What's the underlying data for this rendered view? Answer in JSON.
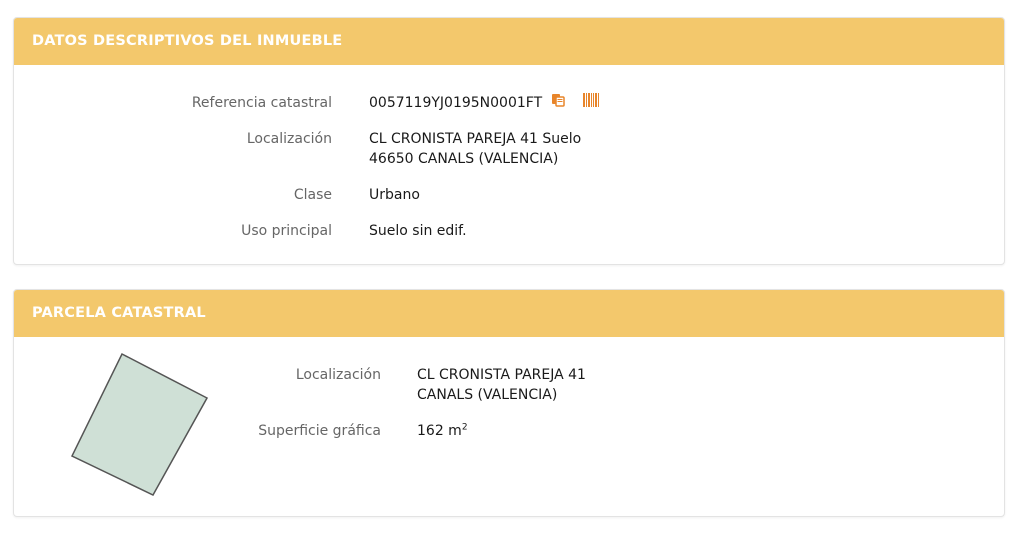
{
  "inmueble": {
    "title": "DATOS DESCRIPTIVOS DEL INMUEBLE",
    "referencia_label": "Referencia catastral",
    "referencia_value": "0057119YJ0195N0001FT",
    "localizacion_label": "Localización",
    "localizacion_line1": "CL CRONISTA PAREJA 41 Suelo",
    "localizacion_line2": "46650 CANALS (VALENCIA)",
    "clase_label": "Clase",
    "clase_value": "Urbano",
    "uso_label": "Uso principal",
    "uso_value": "Suelo sin edif."
  },
  "parcela": {
    "title": "PARCELA CATASTRAL",
    "localizacion_label": "Localización",
    "localizacion_line1": "CL CRONISTA PAREJA 41",
    "localizacion_line2": "CANALS (VALENCIA)",
    "superficie_label": "Superficie gráfica",
    "superficie_value": "162 m",
    "superficie_unit_sup": "2"
  },
  "icons": {
    "copy": "copy-icon",
    "barcode": "barcode-icon"
  },
  "colors": {
    "header_bg": "#f3c86c",
    "header_text": "#ffffff",
    "icon_orange": "#e8852a",
    "parcel_fill": "#cfe0d6",
    "parcel_stroke": "#555555"
  }
}
